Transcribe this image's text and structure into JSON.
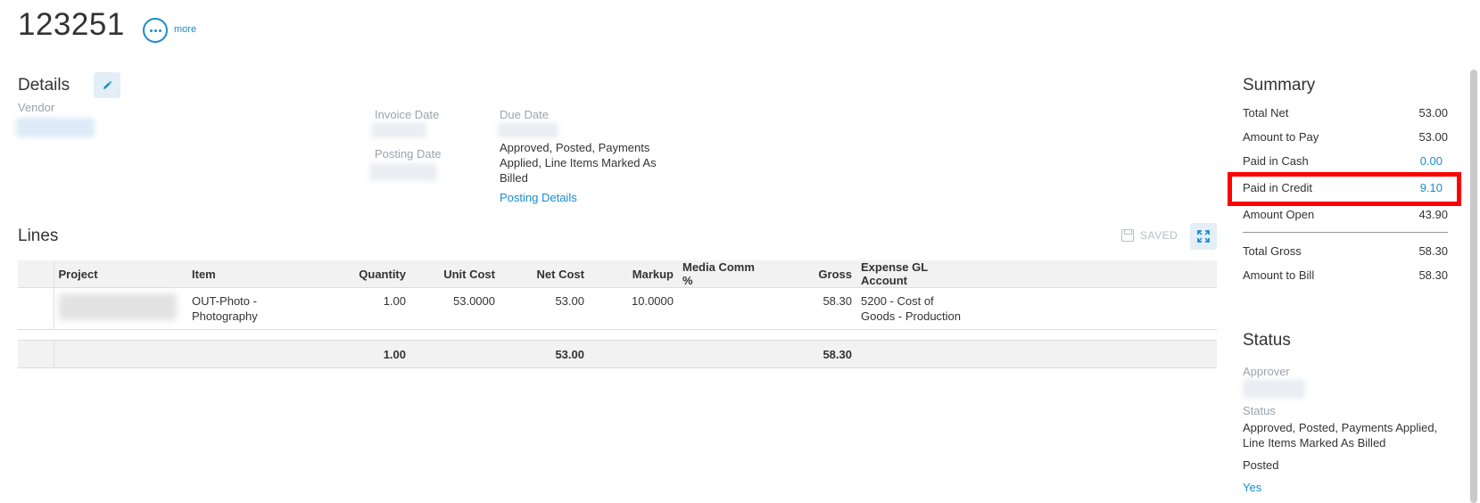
{
  "header": {
    "invoice_number": "123251",
    "more_label": "more"
  },
  "details": {
    "title": "Details",
    "vendor_label": "Vendor",
    "invoice_date_label": "Invoice Date",
    "posting_date_label": "Posting Date",
    "due_date_label": "Due Date",
    "status_text": "Approved, Posted, Payments Applied, Line Items Marked As Billed",
    "posting_details_link": "Posting Details"
  },
  "lines": {
    "title": "Lines",
    "saved_label": "SAVED",
    "columns": [
      "Project",
      "Item",
      "Quantity",
      "Unit Cost",
      "Net Cost",
      "Markup",
      "Media Comm %",
      "Gross",
      "Expense GL Account"
    ],
    "rows": [
      {
        "item": "OUT-Photo - Photography",
        "quantity": "1.00",
        "unit_cost": "53.0000",
        "net_cost": "53.00",
        "markup": "10.0000",
        "media_comm": "",
        "gross": "58.30",
        "gl_account": "5200 - Cost of Goods - Production"
      }
    ],
    "totals": {
      "quantity": "1.00",
      "net_cost": "53.00",
      "gross": "58.30"
    }
  },
  "summary": {
    "title": "Summary",
    "rows": [
      {
        "label": "Total Net",
        "value": "53.00"
      },
      {
        "label": "Amount to Pay",
        "value": "53.00"
      },
      {
        "label": "Paid in Cash",
        "value": "0.00"
      },
      {
        "label": "Paid in Credit",
        "value": "9.10"
      },
      {
        "label": "Amount Open",
        "value": "43.90"
      },
      {
        "label": "Total Gross",
        "value": "58.30"
      },
      {
        "label": "Amount to Bill",
        "value": "58.30"
      }
    ]
  },
  "status_panel": {
    "title": "Status",
    "approver_label": "Approver",
    "status_label": "Status",
    "status_value": "Approved, Posted, Payments Applied, Line Items Marked As Billed",
    "posted_label": "Posted",
    "posted_value": "Yes"
  },
  "colors": {
    "accent": "#1a8bd1",
    "highlight": "#ff0000",
    "table_header_bg": "#f2f2f2"
  }
}
